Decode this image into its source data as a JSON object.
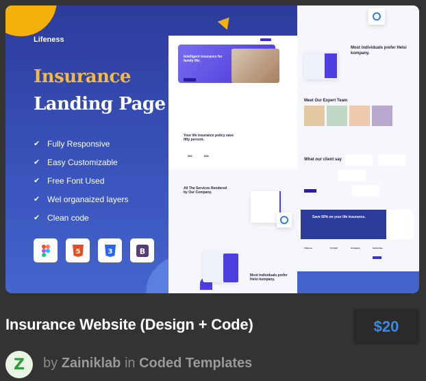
{
  "product": {
    "title": "Insurance Website (Design + Code)",
    "price": "$20",
    "by": "by",
    "author": "Zainiklab",
    "in": "in",
    "category": "Coded Templates",
    "avatar_letter": "Z"
  },
  "thumbnail": {
    "brand": "Lifeness",
    "heading_line1": "Insurance",
    "heading_line2": "Landing Page",
    "features": [
      "Fully Responsive",
      "Easy Customizable",
      "Free Font Used",
      "Wel organaized layers",
      "Clean code"
    ],
    "tools": [
      {
        "name": "figma-icon"
      },
      {
        "name": "html5-icon",
        "label": "5",
        "color": "#e44d26"
      },
      {
        "name": "css3-icon",
        "label": "3",
        "color": "#2965f1"
      },
      {
        "name": "bootstrap-icon",
        "label": "B",
        "color": "#563d7c"
      }
    ],
    "colors": {
      "blue": "#2d3b9c",
      "yellow": "#f5b942",
      "accent": "#4d3ee0"
    },
    "mockup": {
      "hero_title": "Intelligent insurance for family life.",
      "about_title": "Your life insurance policy save fifty percent.",
      "stat1": "30k",
      "stat2": "60k",
      "services_title": "All The Services Rendered by Our Company.",
      "why_title": "Most individuals prefer Helsi kompany.",
      "team_title": "Meet Our Expert  Team",
      "client_title": "What our client say",
      "promo_title": "Save 50% on your life insurance.",
      "footer_brand": "Lifeness",
      "footer_col1": "Contact",
      "footer_col2": "Company",
      "footer_col3": "Subscribe"
    }
  }
}
